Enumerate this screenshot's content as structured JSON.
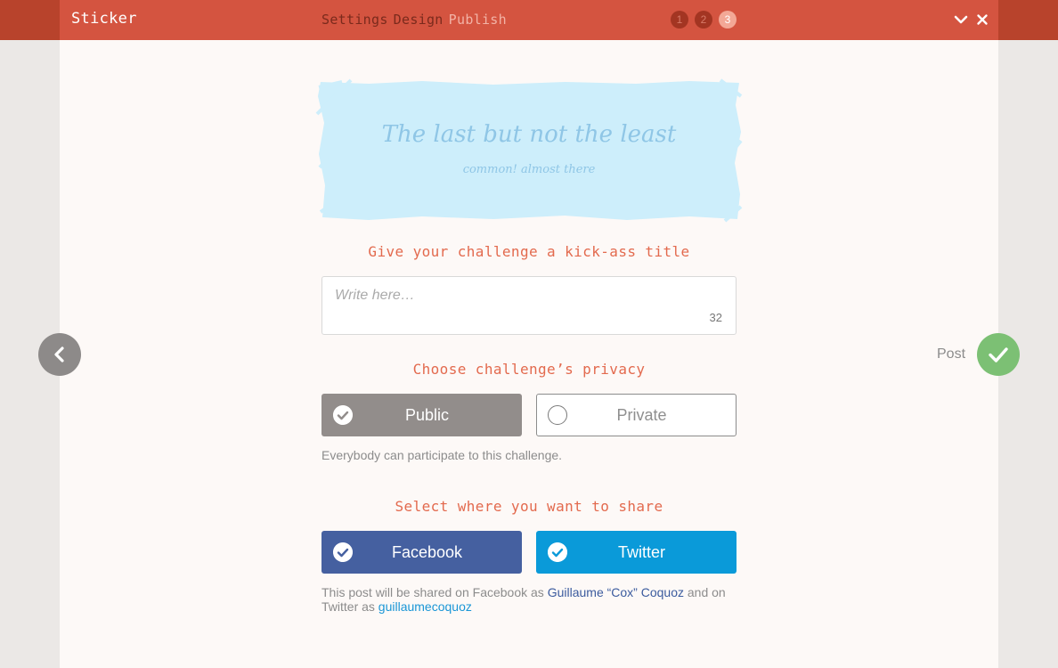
{
  "header": {
    "app_title": "Sticker",
    "steps": [
      "Settings",
      "Design",
      "Publish"
    ],
    "step_numbers": [
      "1",
      "2",
      "3"
    ],
    "active_step": 3
  },
  "sticker": {
    "title": "The last but not the least",
    "subtitle": "common! almost there"
  },
  "title_section": {
    "heading": "Give your challenge a kick-ass title",
    "placeholder": "Write here…",
    "value": "",
    "char_remaining": "32"
  },
  "privacy_section": {
    "heading": "Choose challenge’s privacy",
    "public_label": "Public",
    "private_label": "Private",
    "selected": "Public",
    "description": "Everybody can participate to this challenge."
  },
  "share_section": {
    "heading": "Select where you want to share",
    "facebook_label": "Facebook",
    "twitter_label": "Twitter",
    "note_prefix": "This post will be shared on Facebook as ",
    "facebook_user": "Guillaume “Cox” Coquoz",
    "note_middle": " and on Twitter as ",
    "twitter_user": "guillaumecoquoz"
  },
  "nav": {
    "post_label": "Post"
  },
  "colors": {
    "header": "#d45440",
    "accent": "#e36a4e",
    "facebook": "#4560a0",
    "twitter": "#0a9ad9",
    "post": "#7cc074",
    "sticker": "#cdeefb"
  }
}
